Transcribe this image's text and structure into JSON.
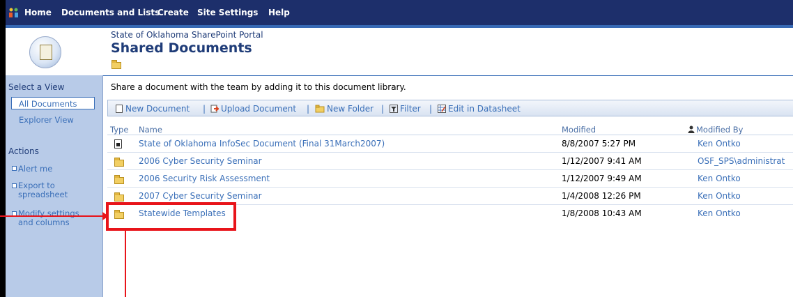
{
  "nav": {
    "items": [
      "Home",
      "Documents and Lists",
      "Create",
      "Site Settings",
      "Help"
    ]
  },
  "header": {
    "portal_name": "State of Oklahoma SharePoint Portal",
    "title": "Shared Documents"
  },
  "sidebar": {
    "select_view_label": "Select a View",
    "views": [
      "All Documents",
      "Explorer View"
    ],
    "actions_label": "Actions",
    "actions": [
      "Alert me",
      "Export to spreadsheet",
      "Modify settings and columns"
    ],
    "actions_lines": [
      [
        "Alert me"
      ],
      [
        "Export to",
        "spreadsheet"
      ],
      [
        "Modify settings",
        "and columns"
      ]
    ]
  },
  "main": {
    "description": "Share a document with the team by adding it to this document library."
  },
  "toolbar": {
    "new_document": "New Document",
    "upload_document": "Upload Document",
    "new_folder": "New Folder",
    "filter": "Filter",
    "edit_datasheet": "Edit in Datasheet",
    "separator": "|"
  },
  "table": {
    "headers": {
      "type": "Type",
      "name": "Name",
      "modified": "Modified",
      "modified_by": "Modified By"
    },
    "rows": [
      {
        "type": "document-icon",
        "name": "State of Oklahoma InfoSec Document (Final 31March2007)",
        "modified": "8/8/2007 5:27 PM",
        "modified_by": "Ken Ontko"
      },
      {
        "type": "folder-icon",
        "name": "2006 Cyber Security Seminar",
        "modified": "1/12/2007 9:41 AM",
        "modified_by": "OSF_SPS\\administrat"
      },
      {
        "type": "folder-icon",
        "name": "2006 Security Risk Assessment",
        "modified": "1/12/2007 9:49 AM",
        "modified_by": "Ken Ontko"
      },
      {
        "type": "folder-icon",
        "name": "2007 Cyber Security Seminar",
        "modified": "1/4/2008 12:26 PM",
        "modified_by": "Ken Ontko"
      },
      {
        "type": "folder-icon",
        "name": "Statewide Templates",
        "modified": "1/8/2008 10:43 AM",
        "modified_by": "Ken Ontko"
      }
    ]
  },
  "colors": {
    "nav_background": "#1d2f6b",
    "sidebar_background": "#b8cbe8",
    "link": "#3a6fb8",
    "title": "#1f3c78",
    "annotation": "#e8141a"
  }
}
